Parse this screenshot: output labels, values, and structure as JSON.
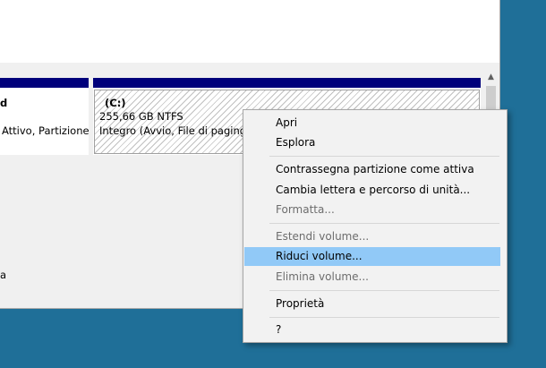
{
  "disk_view": {
    "partition_left": {
      "name": "d",
      "status": "Attivo, Partizione"
    },
    "partition_c": {
      "name": "(C:)",
      "size": "255,66 GB NTFS",
      "status": "Integro (Avvio, File di paging,"
    },
    "bottom_label": "a"
  },
  "context_menu": {
    "items": [
      {
        "label": "Apri",
        "enabled": true
      },
      {
        "label": "Esplora",
        "enabled": true
      },
      {
        "label": "Contrassegna partizione come attiva",
        "enabled": true
      },
      {
        "label": "Cambia lettera e percorso di unità...",
        "enabled": true
      },
      {
        "label": "Formatta...",
        "enabled": false
      },
      {
        "label": "Estendi volume...",
        "enabled": false
      },
      {
        "label": "Riduci volume...",
        "enabled": true,
        "highlighted": true
      },
      {
        "label": "Elimina volume...",
        "enabled": false
      },
      {
        "label": "Proprietà",
        "enabled": true
      },
      {
        "label": "?",
        "enabled": true
      }
    ]
  },
  "colors": {
    "desktop": "#1f6f98",
    "partition_header": "#00007b",
    "menu_highlight": "#91c9f7"
  }
}
